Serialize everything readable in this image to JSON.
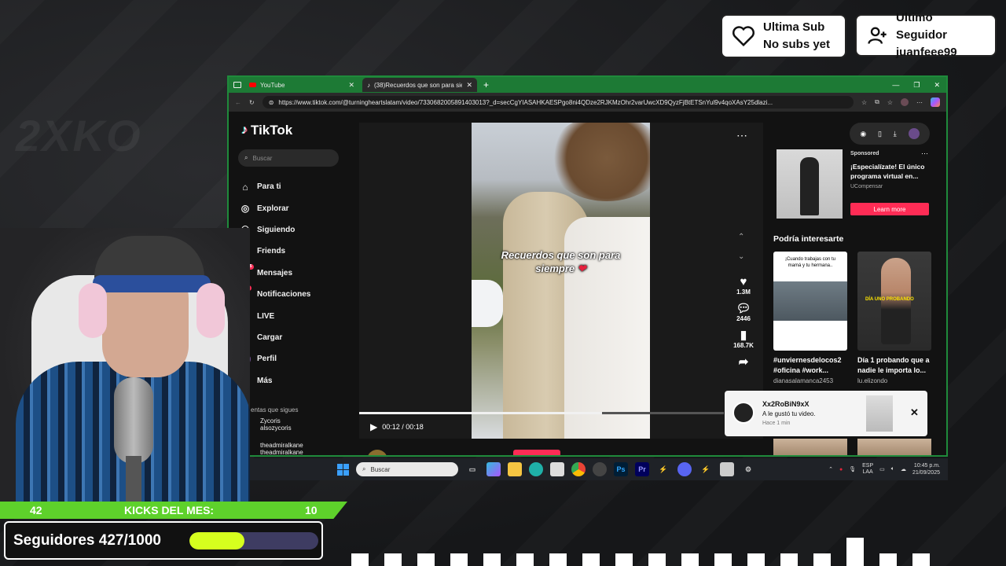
{
  "overlay": {
    "last_sub": {
      "title": "Ultima Sub",
      "value": "No subs yet"
    },
    "last_follower": {
      "title": "Ultimo Seguidor",
      "value": "juanfeee99"
    },
    "kicks": {
      "left_number": "42",
      "label": "KICKS DEL MES:",
      "right_number": "10"
    },
    "followers": {
      "label": "Seguidores 427/1000",
      "progress": 0.427,
      "bar_color": "#d6ff1e"
    }
  },
  "browser": {
    "tabs": [
      {
        "label": "YouTube",
        "icon": "youtube-icon"
      },
      {
        "label": "(38)Recuerdos que son para siemp",
        "icon": "tiktok-icon"
      }
    ],
    "url": "https://www.tiktok.com/@turningheartslatam/video/7330682005891403013?_d=secCgYIASAHKAESPgo8ni4QDze2RJKMzOhr2varUwcXD9QyzFjBtETSnYul9v4qoXAsY25dlazi..."
  },
  "tiktok": {
    "logo": "TikTok",
    "search_placeholder": "Buscar",
    "nav": [
      {
        "label": "Para ti",
        "icon": "home-icon"
      },
      {
        "label": "Explorar",
        "icon": "compass-icon"
      },
      {
        "label": "Siguiendo",
        "icon": "following-icon"
      },
      {
        "label": "Friends",
        "icon": "friends-icon"
      },
      {
        "label": "Mensajes",
        "icon": "message-icon",
        "badge": "55"
      },
      {
        "label": "Notificaciones",
        "icon": "inbox-icon",
        "badge": "3"
      },
      {
        "label": "LIVE",
        "icon": "live-icon"
      },
      {
        "label": "Cargar",
        "icon": "upload-icon"
      },
      {
        "label": "Perfil",
        "icon": "profile-icon"
      },
      {
        "label": "Más",
        "icon": "more-icon"
      }
    ],
    "following_title": "entas que sigues",
    "following": [
      {
        "name": "Zycoris",
        "handle": "alsozycoris"
      },
      {
        "name": "theadmiralkane",
        "handle": "theadmiralkane"
      }
    ],
    "video": {
      "caption_line1": "Recuerdos que son para",
      "caption_line2": "siempre",
      "time": "00:12 / 00:18",
      "progress": 0.667,
      "author": "turningheartslatam"
    },
    "actions": {
      "likes": "1.3M",
      "comments": "2446",
      "saves": "168.7K"
    },
    "ad": {
      "sponsored": "Sponsored",
      "title": "¡Especialízate! El único programa virtual en...",
      "brand": "UCompensar",
      "button": "Learn more"
    },
    "suggested_heading": "Podría interesarte",
    "cards": [
      {
        "title": "#unviernesdelocos2 #oficina #work...",
        "user": "dianasalamanca2453",
        "thumb_text": "¡Cuando trabajas con tu mamá y tu hermana.."
      },
      {
        "title": "Día 1 probando que a nadie le importa lo...",
        "user": "lu.elizondo",
        "thumb_text": "DÍA UNO PROBANDO"
      }
    ],
    "notification": {
      "user": "Xx2RoBiN9xX",
      "message": "A le gustó tu video.",
      "time": "Hace 1 min"
    }
  },
  "taskbar": {
    "search": "Buscar",
    "lang_line1": "ESP",
    "lang_line2": "LAA",
    "time": "10:45 p.m.",
    "date": "21/09/2025"
  },
  "equalizer_levels": [
    0.45,
    0.45,
    0.45,
    0.45,
    0.45,
    0.45,
    0.45,
    0.45,
    0.45,
    0.45,
    0.45,
    0.45,
    0.45,
    0.45,
    0.45,
    1.0,
    0.45,
    0.45
  ]
}
